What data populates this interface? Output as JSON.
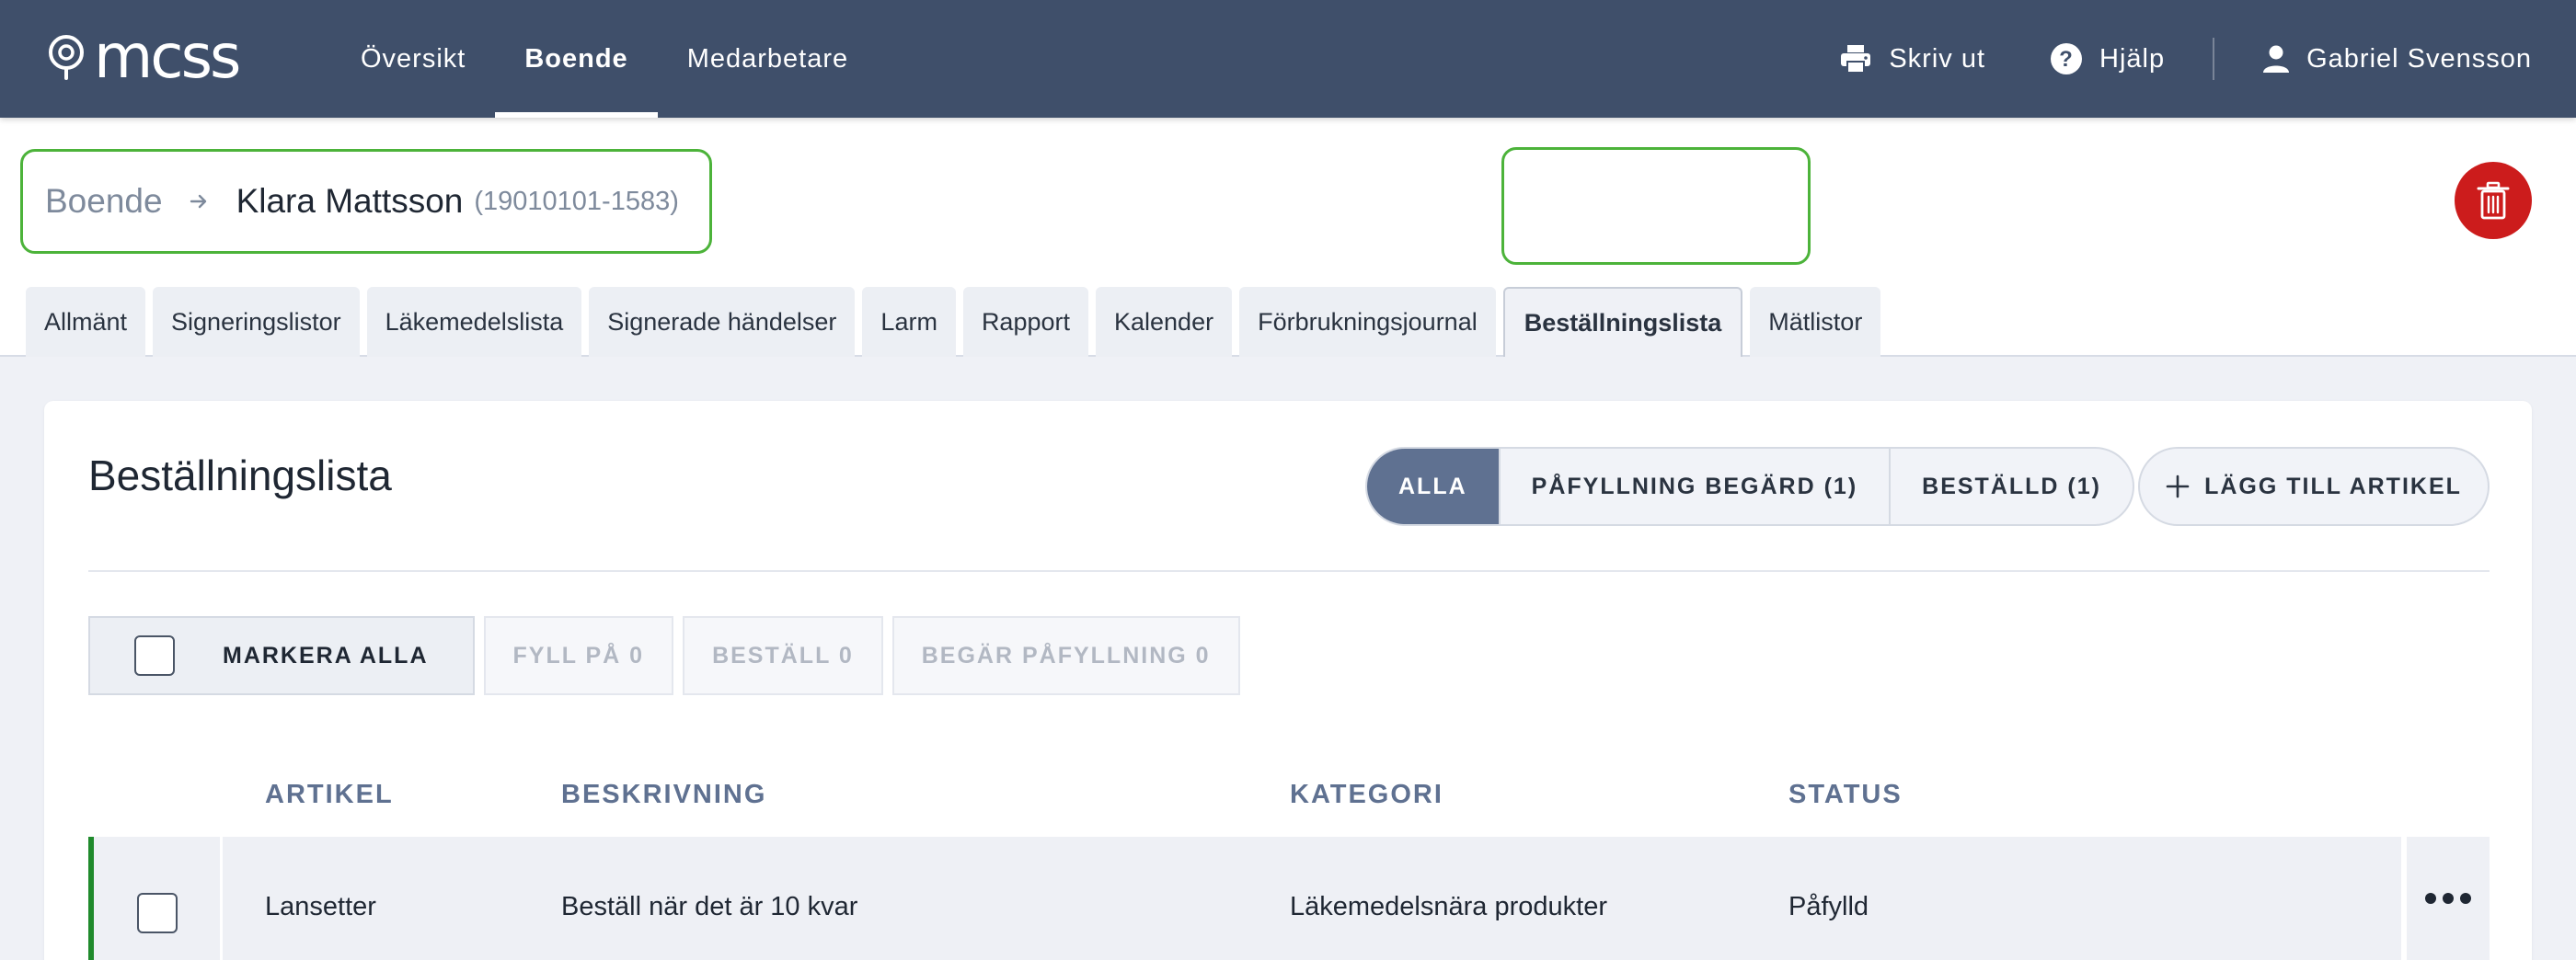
{
  "app": {
    "logo_text": "mcss"
  },
  "nav": {
    "items": [
      {
        "label": "Översikt",
        "active": false
      },
      {
        "label": "Boende",
        "active": true
      },
      {
        "label": "Medarbetare",
        "active": false
      }
    ]
  },
  "top_right": {
    "print_label": "Skriv ut",
    "help_label": "Hjälp",
    "user_name": "Gabriel Svensson"
  },
  "breadcrumb": {
    "root": "Boende",
    "name": "Klara Mattsson",
    "id": "(19010101-1583)"
  },
  "tabs": [
    {
      "label": "Allmänt",
      "active": false
    },
    {
      "label": "Signeringslistor",
      "active": false
    },
    {
      "label": "Läkemedelslista",
      "active": false
    },
    {
      "label": "Signerade händelser",
      "active": false
    },
    {
      "label": "Larm",
      "active": false
    },
    {
      "label": "Rapport",
      "active": false
    },
    {
      "label": "Kalender",
      "active": false
    },
    {
      "label": "Förbrukningsjournal",
      "active": false
    },
    {
      "label": "Beställningslista",
      "active": true
    },
    {
      "label": "Mätlistor",
      "active": false
    }
  ],
  "main": {
    "title": "Beställningslista",
    "filters": [
      {
        "label": "ALLA",
        "active": true
      },
      {
        "label": "PÅFYLLNING BEGÄRD (1)",
        "active": false
      },
      {
        "label": "BESTÄLLD (1)",
        "active": false
      }
    ],
    "add_label": "LÄGG TILL ARTIKEL",
    "actions": {
      "select_all": "MARKERA ALLA",
      "refill": "FYLL PÅ 0",
      "order": "BESTÄLL 0",
      "request_refill": "BEGÄR PÅFYLLNING 0"
    },
    "table": {
      "columns": {
        "article": "ARTIKEL",
        "description": "BESKRIVNING",
        "category": "KATEGORI",
        "status": "STATUS"
      },
      "rows": [
        {
          "article": "Lansetter",
          "description": "Beställ när det är 10 kvar",
          "category": "Läkemedelsnära produkter",
          "status": "Påfylld"
        }
      ]
    }
  },
  "colors": {
    "topbar": "#3f4f6a",
    "accent_active_filter": "#5f7191",
    "delete": "#cc1c1c",
    "highlight": "#4cb33a",
    "row_status_bar": "#1f8a2c"
  }
}
